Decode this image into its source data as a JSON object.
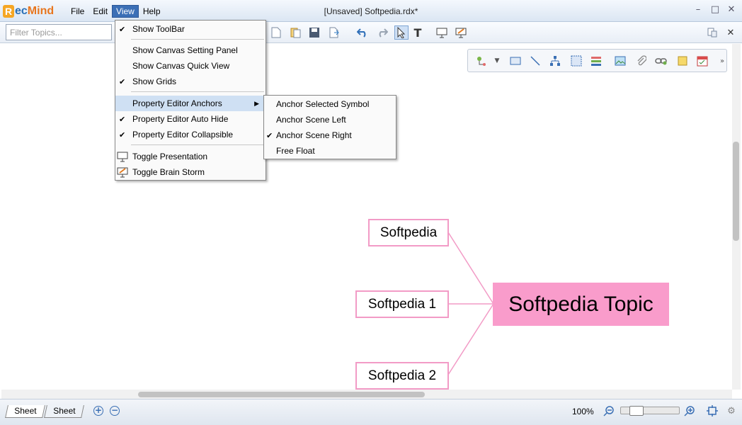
{
  "app": {
    "logo_mark": "R",
    "logo_part1": "ec",
    "logo_part2": "Mind",
    "document_title": "[Unsaved] Softpedia.rdx*"
  },
  "menubar": {
    "items": [
      "File",
      "Edit",
      "View",
      "Help"
    ],
    "active": "View"
  },
  "window_controls": {
    "minimize": "–",
    "maximize": "□",
    "close": "✕"
  },
  "toolbar": {
    "filter_placeholder": "Filter Topics...",
    "icons": [
      "new-icon",
      "open-icon",
      "save-icon",
      "export-icon",
      "undo-icon",
      "redo-icon",
      "select-pointer-icon",
      "text-tool-icon",
      "presentation-icon",
      "brainstorm-icon"
    ],
    "right_icons": [
      "layout-icon",
      "close-panel-icon"
    ]
  },
  "palette": {
    "icons": [
      "topic-style-icon",
      "dropdown-icon",
      "boundary-icon",
      "relationship-icon",
      "structure-icon",
      "selection-box-icon",
      "summary-icon",
      "image-icon",
      "attachment-icon",
      "hyperlink-icon",
      "note-icon",
      "calendar-icon",
      "more-icon"
    ]
  },
  "view_menu": {
    "items": [
      {
        "label": "Show ToolBar",
        "checked": true
      },
      {
        "label": "Show Canvas Setting Panel",
        "checked": false
      },
      {
        "label": "Show Canvas Quick View",
        "checked": false
      },
      {
        "label": "Show Grids",
        "checked": true
      },
      {
        "label": "Property Editor Anchors",
        "checked": false,
        "submenu": true,
        "highlighted": true
      },
      {
        "label": "Property Editor Auto Hide",
        "checked": true
      },
      {
        "label": "Property Editor Collapsible",
        "checked": true
      },
      {
        "label": "Toggle Presentation",
        "icon": "presentation-icon"
      },
      {
        "label": "Toggle Brain Storm",
        "icon": "brainstorm-icon"
      }
    ]
  },
  "anchors_submenu": {
    "items": [
      {
        "label": "Anchor Selected Symbol",
        "checked": false
      },
      {
        "label": "Anchor Scene Left",
        "checked": false
      },
      {
        "label": "Anchor Scene Right",
        "checked": true
      },
      {
        "label": "Free Float",
        "checked": false
      }
    ]
  },
  "mindmap": {
    "central": "Softpedia Topic",
    "subtopics": [
      "Softpedia",
      "Softpedia 1",
      "Softpedia 2"
    ],
    "connector_color": "#f29bc6",
    "central_fill": "#f99ccb"
  },
  "statusbar": {
    "sheets": [
      "Sheet",
      "Sheet"
    ],
    "add_sheet": "+",
    "remove_sheet": "−",
    "zoom": "100%",
    "zoom_level": 0.2
  },
  "colors": {
    "accent": "#3b6fb6",
    "menu_highlight": "#cfe0f3",
    "node_border": "#f29bc6"
  }
}
